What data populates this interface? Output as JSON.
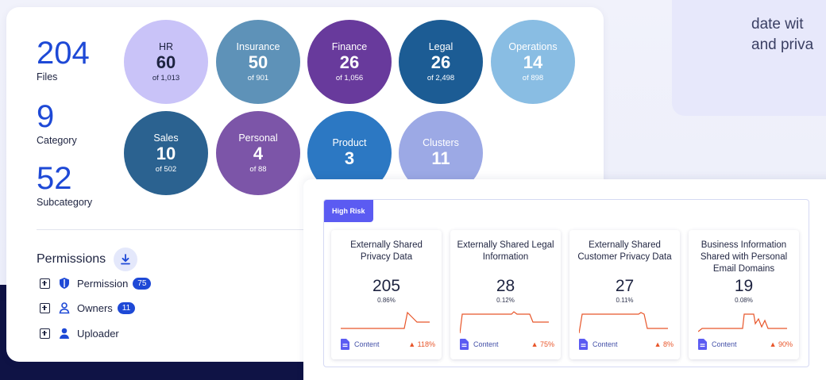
{
  "stats": [
    {
      "value": "204",
      "label": "Files"
    },
    {
      "value": "9",
      "label": "Category"
    },
    {
      "value": "52",
      "label": "Subcategory"
    }
  ],
  "categories": [
    {
      "label": "HR",
      "count": "60",
      "sub": "of 1,013",
      "color": "#c9c3f8"
    },
    {
      "label": "Insurance",
      "count": "50",
      "sub": "of 901",
      "color": "#5e92b8"
    },
    {
      "label": "Finance",
      "count": "26",
      "sub": "of 1,056",
      "color": "#683a9c"
    },
    {
      "label": "Legal",
      "count": "26",
      "sub": "of 2,498",
      "color": "#1c5c94"
    },
    {
      "label": "Operations",
      "count": "14",
      "sub": "of 898",
      "color": "#89bde3"
    },
    {
      "label": "Sales",
      "count": "10",
      "sub": "of 502",
      "color": "#2b6290"
    },
    {
      "label": "Personal",
      "count": "4",
      "sub": "of 88",
      "color": "#7c55a8"
    },
    {
      "label": "Product",
      "count": "3",
      "sub": "",
      "color": "#2c78c3"
    },
    {
      "label": "Clusters",
      "count": "11",
      "sub": "",
      "color": "#9ca9e5"
    }
  ],
  "permissions": {
    "title": "Permissions",
    "rows": [
      {
        "label": "Permission",
        "badge": "75"
      },
      {
        "label": "Owners",
        "badge": "11"
      },
      {
        "label": "Uploader",
        "badge": ""
      }
    ]
  },
  "right_card": {
    "line1": "date wit",
    "line2": "and priva"
  },
  "risk": {
    "tag": "High Risk",
    "cards": [
      {
        "title": "Externally Shared Privacy Data",
        "count": "205",
        "pct": "0.86%",
        "content": "Content",
        "trend": "▲ 118%"
      },
      {
        "title": "Externally Shared Legal Information",
        "count": "28",
        "pct": "0.12%",
        "content": "Content",
        "trend": "▲ 75%"
      },
      {
        "title": "Externally Shared Customer Privacy Data",
        "count": "27",
        "pct": "0.11%",
        "content": "Content",
        "trend": "▲ 8%"
      },
      {
        "title": "Business Information Shared with Personal Email Domains",
        "count": "19",
        "pct": "0.08%",
        "content": "Content",
        "trend": "▲ 90%"
      }
    ]
  },
  "colors": {
    "accent": "#1e49d6",
    "trend": "#e8562a",
    "tag": "#5b5bf2"
  }
}
